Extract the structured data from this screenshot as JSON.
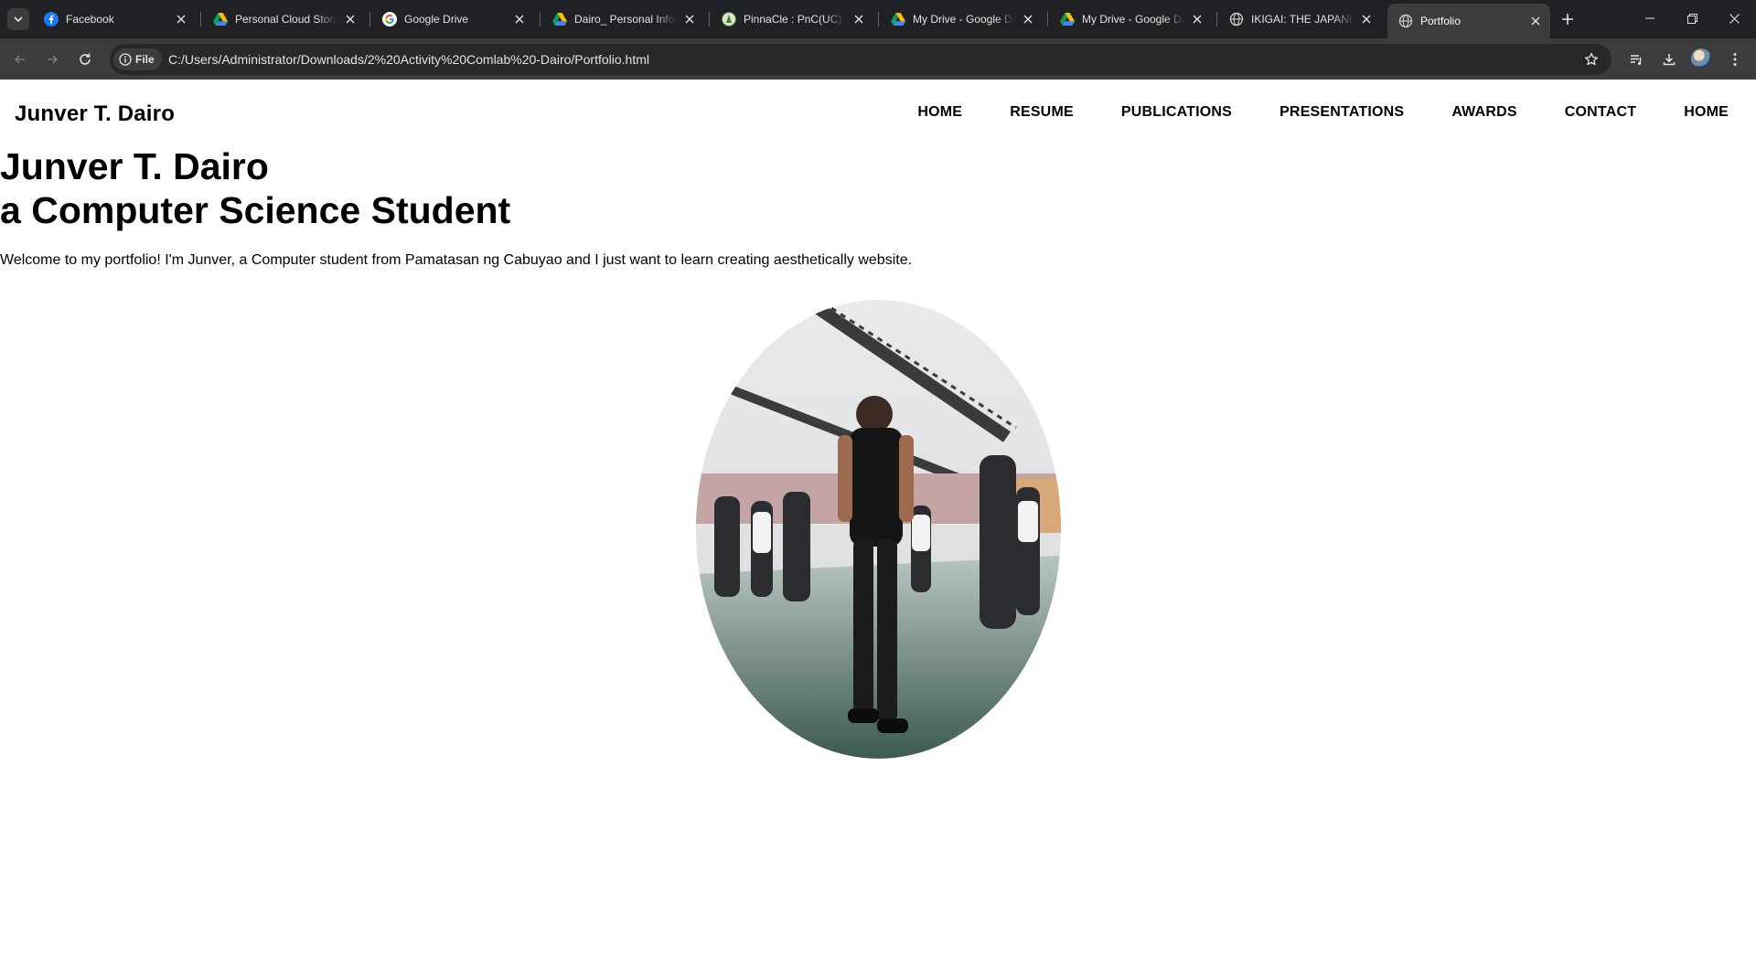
{
  "browser": {
    "tabs": [
      {
        "title": "Facebook",
        "icon": "facebook-icon",
        "active": false
      },
      {
        "title": "Personal Cloud Storage",
        "icon": "google-drive-icon",
        "active": false
      },
      {
        "title": "Google Drive",
        "icon": "google-icon",
        "active": false
      },
      {
        "title": "Dairo_ Personal Information",
        "icon": "google-drive-icon",
        "active": false
      },
      {
        "title": "PinnaCle : PnC(UC) Learning",
        "icon": "pinnacle-icon",
        "active": false
      },
      {
        "title": "My Drive - Google Drive",
        "icon": "google-drive-icon",
        "active": false
      },
      {
        "title": "My Drive - Google Drive",
        "icon": "google-drive-icon",
        "active": false
      },
      {
        "title": "IKIGAI: THE JAPANESE",
        "icon": "globe-icon",
        "active": false
      },
      {
        "title": "Portfolio",
        "icon": "globe-icon",
        "active": true
      }
    ],
    "site_chip_label": "File",
    "url": "C:/Users/Administrator/Downloads/2%20Activity%20Comlab%20-Dairo/Portfolio.html",
    "colors": {
      "chrome_bg": "#202124",
      "toolbar_bg": "#3c3c3c",
      "omnibox_bg": "#282828",
      "text": "#e3e3e3"
    }
  },
  "site": {
    "brand": "Junver T. Dairo",
    "nav": [
      "HOME",
      "RESUME",
      "PUBLICATIONS",
      "PRESENTATIONS",
      "AWARDS",
      "CONTACT",
      "HOME"
    ],
    "hero": {
      "name": "Junver T. Dairo",
      "sub_prefix": "a",
      "sub_text": "Computer Science Student",
      "welcome": "Welcome to my portfolio! I'm Junver, a Computer student from Pamatasan ng Cabuyao and I just want to learn creating aesthetically website."
    },
    "portrait_icon": "profile-photo"
  }
}
